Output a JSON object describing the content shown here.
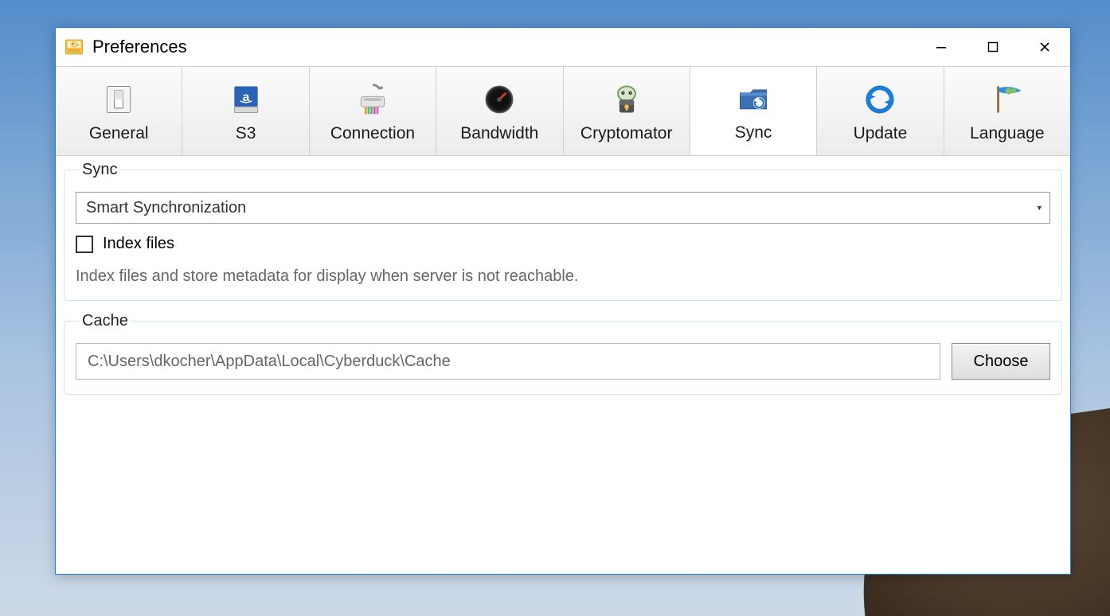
{
  "window": {
    "title": "Preferences"
  },
  "tabs": [
    {
      "label": "General",
      "icon": "switch"
    },
    {
      "label": "S3",
      "icon": "s3"
    },
    {
      "label": "Connection",
      "icon": "shredder"
    },
    {
      "label": "Bandwidth",
      "icon": "gauge"
    },
    {
      "label": "Cryptomator",
      "icon": "cryptomator"
    },
    {
      "label": "Sync",
      "icon": "sync-folder",
      "active": true
    },
    {
      "label": "Update",
      "icon": "refresh"
    },
    {
      "label": "Language",
      "icon": "flag"
    }
  ],
  "sync": {
    "legend": "Sync",
    "mode": "Smart Synchronization",
    "index_label": "Index files",
    "index_checked": false,
    "hint": "Index files and store metadata for display when server is not reachable."
  },
  "cache": {
    "legend": "Cache",
    "path": "C:\\Users\\dkocher\\AppData\\Local\\Cyberduck\\Cache",
    "choose_label": "Choose"
  }
}
